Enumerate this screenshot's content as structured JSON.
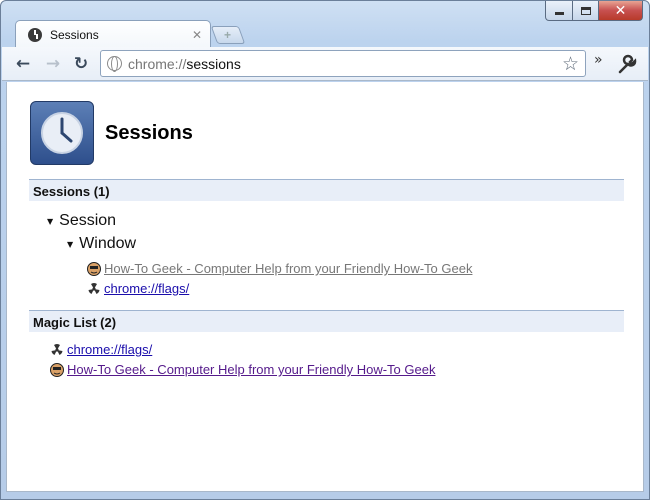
{
  "window": {
    "controls": {
      "minimize": "minimize",
      "maximize": "maximize",
      "close": "✕"
    }
  },
  "tab": {
    "title": "Sessions",
    "close_label": "✕"
  },
  "toolbar": {
    "back_label": "←",
    "forward_label": "→",
    "reload_label": "↻",
    "url_scheme": "chrome://",
    "url_path": "sessions",
    "bookmark_star": "☆",
    "more_label": "»"
  },
  "page": {
    "title": "Sessions",
    "sessions_section": {
      "header": "Sessions (1)",
      "session_label": "Session",
      "window_label": "Window",
      "links": [
        {
          "text": "How-To Geek - Computer Help from your Friendly How-To Geek",
          "icon": "howtogeek-favicon"
        },
        {
          "text": "chrome://flags/",
          "icon": "radiation-icon"
        }
      ]
    },
    "magic_section": {
      "header": "Magic List (2)",
      "links": [
        {
          "text": "chrome://flags/",
          "icon": "radiation-icon"
        },
        {
          "text": "How-To Geek - Computer Help from your Friendly How-To Geek",
          "icon": "howtogeek-favicon"
        }
      ]
    }
  },
  "colors": {
    "section_bg": "#e8eef8",
    "visited_link": "#777777",
    "link": "#1a0dab",
    "visited_purple": "#551a8b"
  }
}
